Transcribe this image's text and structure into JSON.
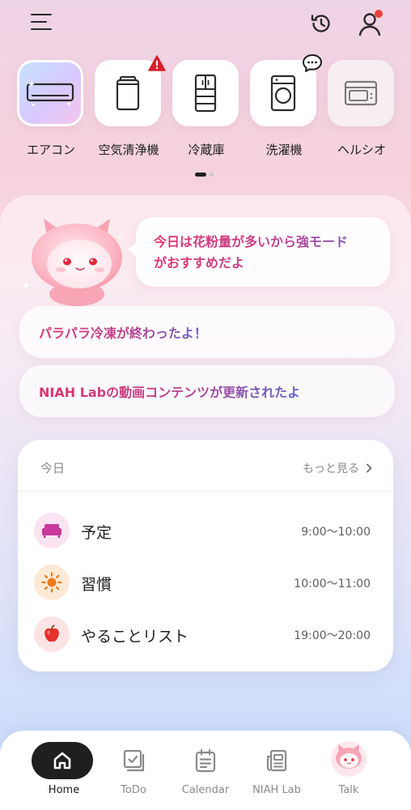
{
  "header": {
    "menu_icon": "hamburger-menu-icon",
    "history_icon": "history-clock-icon",
    "profile_icon": "user-icon",
    "notification_dot_color": "#e8403a"
  },
  "devices": [
    {
      "label": "エアコン",
      "icon": "air-conditioner-icon",
      "selected": true
    },
    {
      "label": "空気清浄機",
      "icon": "air-purifier-icon",
      "badge": "alert-icon"
    },
    {
      "label": "冷蔵庫",
      "icon": "refrigerator-icon"
    },
    {
      "label": "洗濯機",
      "icon": "washing-machine-icon",
      "badge": "chat-bubble-icon"
    },
    {
      "label": "ヘルシオ",
      "icon": "microwave-oven-icon"
    }
  ],
  "pager": {
    "pages": 2,
    "current": 1
  },
  "assistant": {
    "mascot": "cat-mascot",
    "bubble_text_line1": "今日は花粉量が多いから強モード",
    "bubble_text_line2": "がおすすめだよ"
  },
  "notices": [
    {
      "text": "パラパラ冷凍が終わったよ！"
    },
    {
      "text": "NIAH Labの動画コンテンツが更新されたよ"
    }
  ],
  "today": {
    "title": "今日",
    "more_label": "もっと見る",
    "items": [
      {
        "label": "予定",
        "time": "9:00～10:00",
        "icon": "sofa-icon",
        "icon_bg": "#fbe3f1"
      },
      {
        "label": "習慣",
        "time": "10:00～11:00",
        "icon": "sun-icon",
        "icon_bg": "#fde9d6"
      },
      {
        "label": "やることリスト",
        "time": "19:00～20:00",
        "icon": "apple-icon",
        "icon_bg": "#fde4e4"
      }
    ]
  },
  "tabs": [
    {
      "label": "Home",
      "icon": "home-icon",
      "active": true
    },
    {
      "label": "ToDo",
      "icon": "todo-checklist-icon"
    },
    {
      "label": "Calendar",
      "icon": "calendar-icon"
    },
    {
      "label": "NIAH Lab",
      "icon": "news-icon"
    },
    {
      "label": "Talk",
      "icon": "mascot-avatar-icon"
    }
  ],
  "colors": {
    "accent_pink": "#e0336e",
    "accent_purple": "#6f5ac4",
    "tab_active": "#1f1f1f"
  }
}
